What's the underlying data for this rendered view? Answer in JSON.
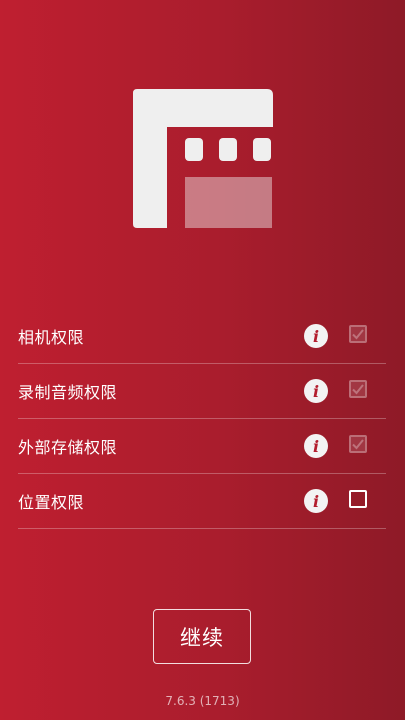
{
  "permissions": [
    {
      "label": "相机权限",
      "checked": true
    },
    {
      "label": "录制音频权限",
      "checked": true
    },
    {
      "label": "外部存储权限",
      "checked": true
    },
    {
      "label": "位置权限",
      "checked": false
    }
  ],
  "info_icon_glyph": "i",
  "continue_label": "继续",
  "version": "7.6.3 (1713)",
  "colors": {
    "background_start": "#bf1f30",
    "background_end": "#8e1a27",
    "accent_white": "#f0f0f0"
  }
}
